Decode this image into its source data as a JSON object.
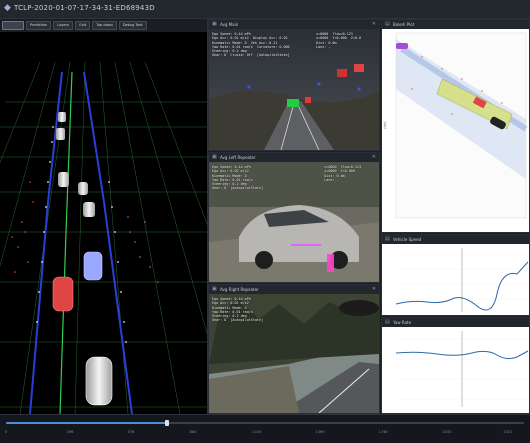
{
  "app": {
    "title": "TCLP-2020-01-07-17-34-31-ED68943D"
  },
  "toolbar": {
    "tabs": [
      "",
      "Prediction",
      "Layers",
      "Grid",
      "Top down",
      "Debug Text"
    ]
  },
  "panels": {
    "main": {
      "title": "Avg Main",
      "overlay_left": "Ego Speed: 6.44 mPh\nEgo Acc: 0.02 m/s2  Display Acc: 0.02\nKinematic Mode: D  Veh Acc: 0.11\nYaw Rate: 0.01 rad/s  Curvature: 0.000\nSteering: 0.2 deg\nGear: D  Cruise: Off  [AutopilotState]",
      "overlay_right": "x=0000  flow=0.123\nx=0000  Y=0.000  Z=0.0\nDist: 0.0m\nLane: -"
    },
    "left_repeater": {
      "title": "Avg Left Repeater",
      "overlay_left": "Ego Speed: 6.44 mPh\nEgo Acc: 0.02 m/s2\nKinematic Mode: D\nYaw Rate: 0.01 rad/s\nSteering: 0.2 deg\nGear: D  [AutopilotState]",
      "overlay_right": "x=0000  flow=0.123\nx=0000  Y=0.000\nDist: 0.0m\nLane: -"
    },
    "right_repeater": {
      "title": "Avg Right Repeater",
      "overlay_left": "Ego Speed: 6.44 mPh\nEgo Acc: 0.02 m/s2\nKinematic Mode: D\nYaw Rate: 0.01 rad/s\nSteering: 0.2 deg\nGear: D  [AutopilotState]"
    },
    "bokeh": {
      "title": "Bokeh Plot"
    },
    "speed": {
      "title": "Vehicle Speed"
    },
    "yaw": {
      "title": "Yaw Rate"
    }
  },
  "timeline": {
    "progress": 0.31,
    "ticks": [
      "0",
      "296",
      "576",
      "860",
      "1155",
      "1469",
      "1746",
      "2033",
      "2311"
    ]
  },
  "colors": {
    "accent": "#4f8fd8",
    "ego_car": "#e04545",
    "lead_car": "#9aa8ff"
  }
}
